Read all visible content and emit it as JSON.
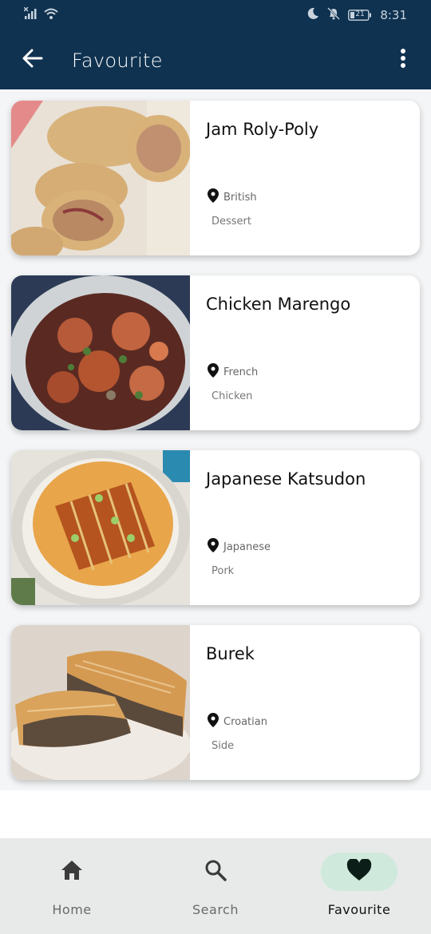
{
  "status_bar": {
    "time": "8:31",
    "battery": "21",
    "icons": [
      "signal-icon",
      "wifi-icon",
      "moon-icon",
      "mute-bell-icon",
      "battery-icon"
    ]
  },
  "app_bar": {
    "title": "Favourite",
    "back_icon": "arrow-left-icon",
    "menu_icon": "more-vertical-icon"
  },
  "favourites": [
    {
      "name": "Jam Roly-Poly",
      "area": "British",
      "category": "Dessert"
    },
    {
      "name": "Chicken Marengo",
      "area": "French",
      "category": "Chicken"
    },
    {
      "name": "Japanese Katsudon",
      "area": "Japanese",
      "category": "Pork"
    },
    {
      "name": "Burek",
      "area": "Croatian",
      "category": "Side"
    }
  ],
  "bottom_nav": {
    "items": [
      {
        "label": "Home",
        "icon": "home-icon"
      },
      {
        "label": "Search",
        "icon": "search-icon"
      },
      {
        "label": "Favourite",
        "icon": "heart-icon"
      }
    ],
    "active": "Favourite"
  },
  "colors": {
    "app_bar": "#0f3250",
    "active_pill": "#cfe9dc",
    "nav_background": "#e7eae9"
  }
}
